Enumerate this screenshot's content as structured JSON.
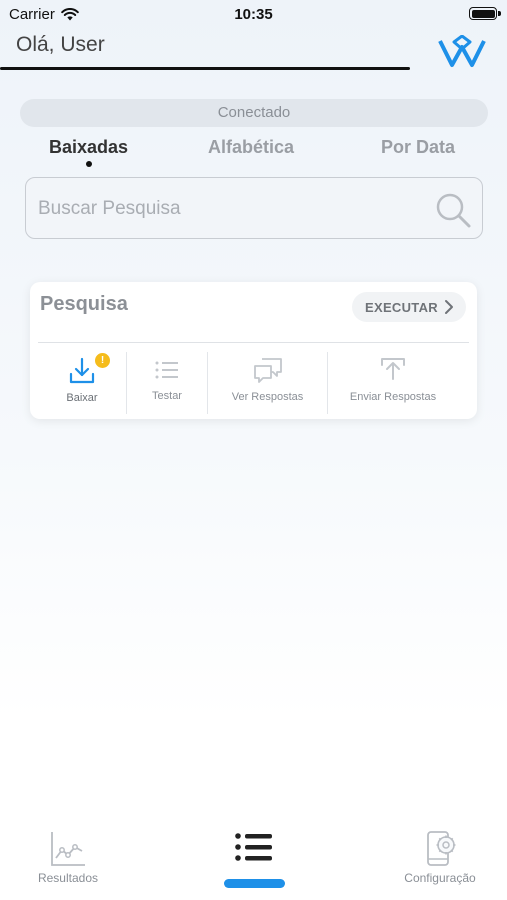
{
  "status_bar": {
    "carrier": "Carrier",
    "time": "10:35"
  },
  "header": {
    "greeting": "Olá, User"
  },
  "connection": {
    "status": "Conectado"
  },
  "tabs": [
    {
      "label": "Baixadas",
      "active": true
    },
    {
      "label": "Alfabética",
      "active": false
    },
    {
      "label": "Por Data",
      "active": false
    }
  ],
  "search": {
    "placeholder": "Buscar Pesquisa",
    "value": ""
  },
  "survey_card": {
    "title": "Pesquisa",
    "run_label": "EXECUTAR",
    "actions": [
      {
        "label": "Baixar",
        "icon": "download-icon",
        "badge": "!"
      },
      {
        "label": "Testar",
        "icon": "list-icon"
      },
      {
        "label": "Ver Respostas",
        "icon": "chat-bubbles-icon"
      },
      {
        "label": "Enviar Respostas",
        "icon": "upload-icon"
      }
    ]
  },
  "bottom_nav": {
    "items": [
      {
        "label": "Resultados",
        "icon": "chart-icon"
      },
      {
        "label": "",
        "icon": "list-icon",
        "active": true
      },
      {
        "label": "Configuração",
        "icon": "phone-settings-icon"
      }
    ]
  },
  "colors": {
    "accent": "#1e90e8",
    "badge": "#f5bc1c",
    "logo": "#1e90e8"
  }
}
